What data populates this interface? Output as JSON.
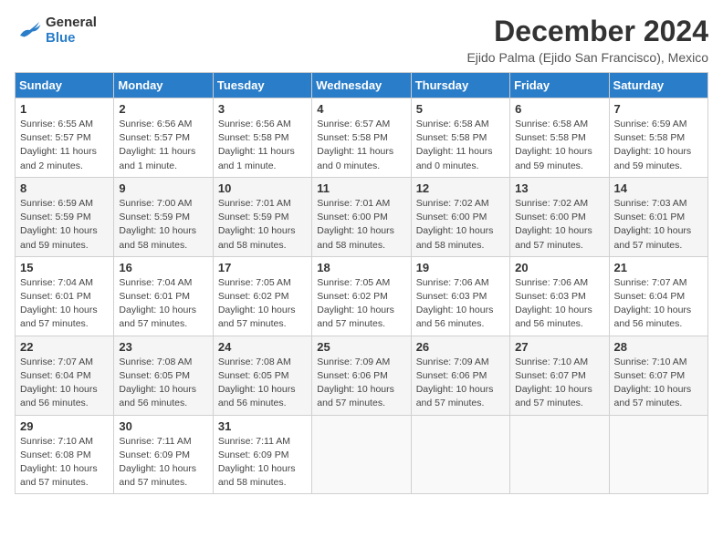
{
  "header": {
    "logo_line1": "General",
    "logo_line2": "Blue",
    "month_year": "December 2024",
    "location": "Ejido Palma (Ejido San Francisco), Mexico"
  },
  "weekdays": [
    "Sunday",
    "Monday",
    "Tuesday",
    "Wednesday",
    "Thursday",
    "Friday",
    "Saturday"
  ],
  "weeks": [
    [
      {
        "day": "1",
        "sunrise": "6:55 AM",
        "sunset": "5:57 PM",
        "daylight": "11 hours and 2 minutes."
      },
      {
        "day": "2",
        "sunrise": "6:56 AM",
        "sunset": "5:57 PM",
        "daylight": "11 hours and 1 minute."
      },
      {
        "day": "3",
        "sunrise": "6:56 AM",
        "sunset": "5:58 PM",
        "daylight": "11 hours and 1 minute."
      },
      {
        "day": "4",
        "sunrise": "6:57 AM",
        "sunset": "5:58 PM",
        "daylight": "11 hours and 0 minutes."
      },
      {
        "day": "5",
        "sunrise": "6:58 AM",
        "sunset": "5:58 PM",
        "daylight": "11 hours and 0 minutes."
      },
      {
        "day": "6",
        "sunrise": "6:58 AM",
        "sunset": "5:58 PM",
        "daylight": "10 hours and 59 minutes."
      },
      {
        "day": "7",
        "sunrise": "6:59 AM",
        "sunset": "5:58 PM",
        "daylight": "10 hours and 59 minutes."
      }
    ],
    [
      {
        "day": "8",
        "sunrise": "6:59 AM",
        "sunset": "5:59 PM",
        "daylight": "10 hours and 59 minutes."
      },
      {
        "day": "9",
        "sunrise": "7:00 AM",
        "sunset": "5:59 PM",
        "daylight": "10 hours and 58 minutes."
      },
      {
        "day": "10",
        "sunrise": "7:01 AM",
        "sunset": "5:59 PM",
        "daylight": "10 hours and 58 minutes."
      },
      {
        "day": "11",
        "sunrise": "7:01 AM",
        "sunset": "6:00 PM",
        "daylight": "10 hours and 58 minutes."
      },
      {
        "day": "12",
        "sunrise": "7:02 AM",
        "sunset": "6:00 PM",
        "daylight": "10 hours and 58 minutes."
      },
      {
        "day": "13",
        "sunrise": "7:02 AM",
        "sunset": "6:00 PM",
        "daylight": "10 hours and 57 minutes."
      },
      {
        "day": "14",
        "sunrise": "7:03 AM",
        "sunset": "6:01 PM",
        "daylight": "10 hours and 57 minutes."
      }
    ],
    [
      {
        "day": "15",
        "sunrise": "7:04 AM",
        "sunset": "6:01 PM",
        "daylight": "10 hours and 57 minutes."
      },
      {
        "day": "16",
        "sunrise": "7:04 AM",
        "sunset": "6:01 PM",
        "daylight": "10 hours and 57 minutes."
      },
      {
        "day": "17",
        "sunrise": "7:05 AM",
        "sunset": "6:02 PM",
        "daylight": "10 hours and 57 minutes."
      },
      {
        "day": "18",
        "sunrise": "7:05 AM",
        "sunset": "6:02 PM",
        "daylight": "10 hours and 57 minutes."
      },
      {
        "day": "19",
        "sunrise": "7:06 AM",
        "sunset": "6:03 PM",
        "daylight": "10 hours and 56 minutes."
      },
      {
        "day": "20",
        "sunrise": "7:06 AM",
        "sunset": "6:03 PM",
        "daylight": "10 hours and 56 minutes."
      },
      {
        "day": "21",
        "sunrise": "7:07 AM",
        "sunset": "6:04 PM",
        "daylight": "10 hours and 56 minutes."
      }
    ],
    [
      {
        "day": "22",
        "sunrise": "7:07 AM",
        "sunset": "6:04 PM",
        "daylight": "10 hours and 56 minutes."
      },
      {
        "day": "23",
        "sunrise": "7:08 AM",
        "sunset": "6:05 PM",
        "daylight": "10 hours and 56 minutes."
      },
      {
        "day": "24",
        "sunrise": "7:08 AM",
        "sunset": "6:05 PM",
        "daylight": "10 hours and 56 minutes."
      },
      {
        "day": "25",
        "sunrise": "7:09 AM",
        "sunset": "6:06 PM",
        "daylight": "10 hours and 57 minutes."
      },
      {
        "day": "26",
        "sunrise": "7:09 AM",
        "sunset": "6:06 PM",
        "daylight": "10 hours and 57 minutes."
      },
      {
        "day": "27",
        "sunrise": "7:10 AM",
        "sunset": "6:07 PM",
        "daylight": "10 hours and 57 minutes."
      },
      {
        "day": "28",
        "sunrise": "7:10 AM",
        "sunset": "6:07 PM",
        "daylight": "10 hours and 57 minutes."
      }
    ],
    [
      {
        "day": "29",
        "sunrise": "7:10 AM",
        "sunset": "6:08 PM",
        "daylight": "10 hours and 57 minutes."
      },
      {
        "day": "30",
        "sunrise": "7:11 AM",
        "sunset": "6:09 PM",
        "daylight": "10 hours and 57 minutes."
      },
      {
        "day": "31",
        "sunrise": "7:11 AM",
        "sunset": "6:09 PM",
        "daylight": "10 hours and 58 minutes."
      },
      null,
      null,
      null,
      null
    ]
  ]
}
